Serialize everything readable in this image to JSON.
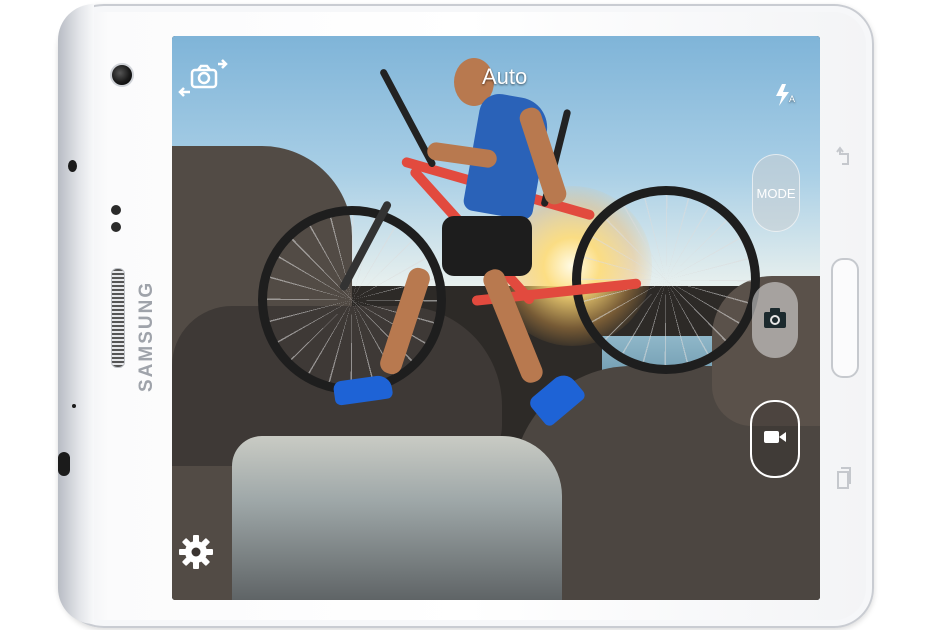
{
  "device": {
    "brand": "SAMSUNG"
  },
  "camera_ui": {
    "mode_indicator": "Auto",
    "mode_button_label": "MODE",
    "flash_setting": "A",
    "icons": {
      "switch_camera": "switch-camera-icon",
      "flash": "flash-auto-icon",
      "shutter": "camera-icon",
      "record": "video-camera-icon",
      "settings": "gear-icon"
    }
  },
  "hardware_keys": {
    "back": "back-icon",
    "home": "home-button",
    "recent": "recent-apps-icon"
  },
  "colors": {
    "overlay_text": "#ffffff",
    "phone_body": "#ffffff",
    "bike_frame": "#e24a3e",
    "shirt": "#2a62b8"
  }
}
